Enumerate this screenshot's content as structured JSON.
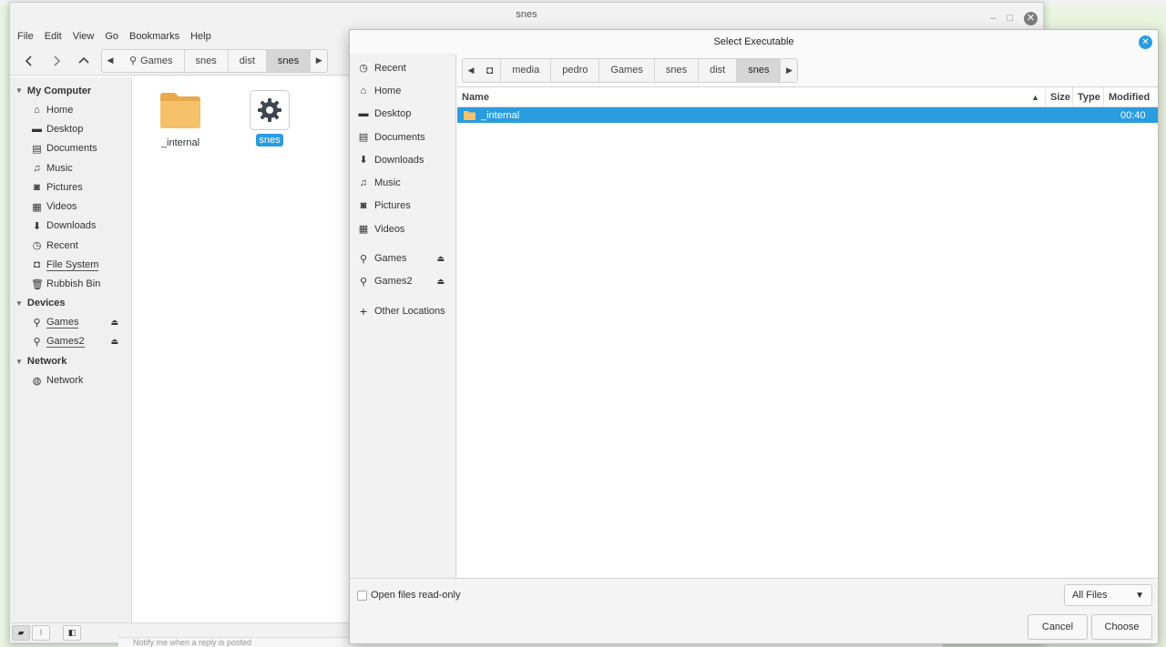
{
  "nemo": {
    "title": "snes",
    "window_minimize": "–",
    "window_maximize": "□",
    "window_close": "✕",
    "menu": [
      "File",
      "Edit",
      "View",
      "Go",
      "Bookmarks",
      "Help"
    ],
    "breadcrumb": [
      "Games",
      "snes",
      "dist",
      "snes"
    ],
    "sidebar": {
      "my_computer": "My Computer",
      "items": [
        "Home",
        "Desktop",
        "Documents",
        "Music",
        "Pictures",
        "Videos",
        "Downloads",
        "Recent",
        "File System",
        "Rubbish Bin"
      ],
      "devices": "Devices",
      "device_items": [
        "Games",
        "Games2"
      ],
      "network": "Network",
      "network_items": [
        "Network"
      ]
    },
    "files": [
      {
        "name": "_internal",
        "type": "folder"
      },
      {
        "name": "snes",
        "type": "executable"
      }
    ]
  },
  "background_status": "Notify me when a reply is posted",
  "dialog": {
    "title": "Select Executable",
    "close": "✕",
    "sidebar": {
      "places": [
        "Recent",
        "Home",
        "Desktop",
        "Documents",
        "Downloads",
        "Music",
        "Pictures",
        "Videos"
      ],
      "devices": [
        "Games",
        "Games2"
      ],
      "other": "Other Locations"
    },
    "path": [
      "media",
      "pedro",
      "Games",
      "snes",
      "dist",
      "snes"
    ],
    "columns": {
      "name": "Name",
      "size": "Size",
      "type": "Type",
      "modified": "Modified"
    },
    "rows": [
      {
        "name": "_internal",
        "size": "",
        "type": "",
        "modified": "00:40"
      }
    ],
    "read_only_label": "Open files read-only",
    "filter": "All Files",
    "cancel": "Cancel",
    "choose": "Choose"
  },
  "colors": {
    "accent": "#2a9ce0",
    "folder": "#f5c26b"
  }
}
